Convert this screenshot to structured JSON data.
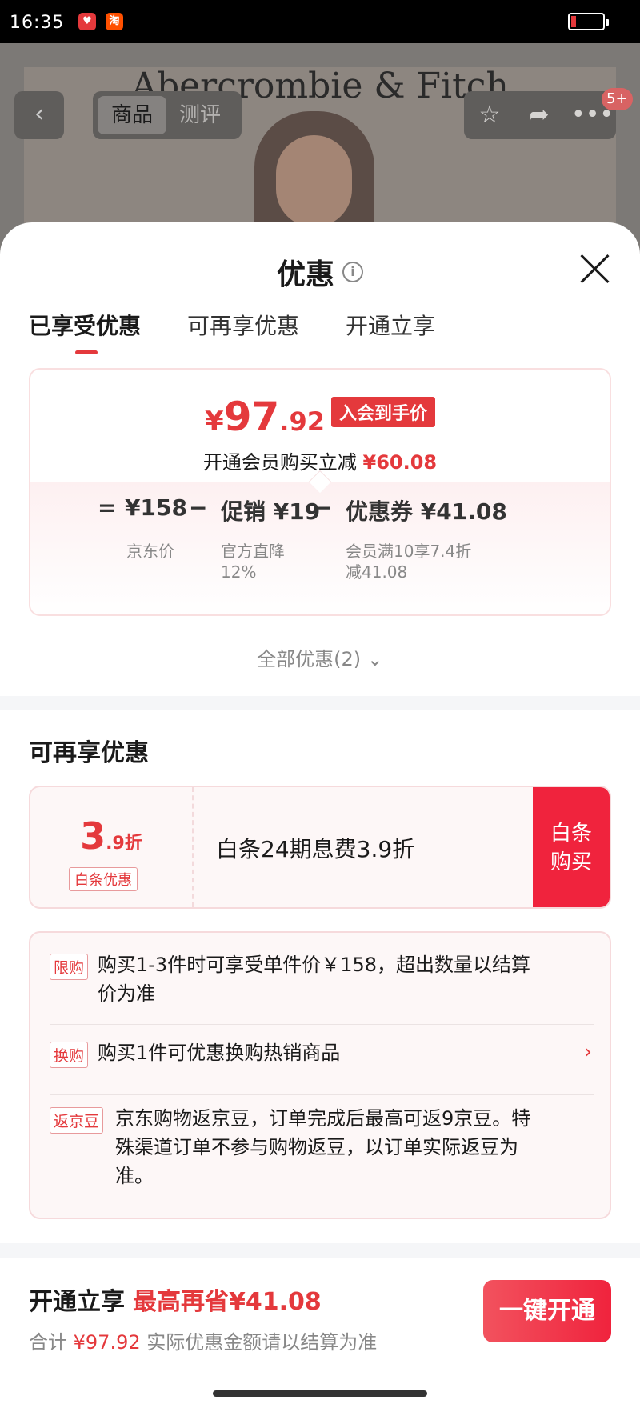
{
  "status_bar": {
    "time": "16:35",
    "app_icons": [
      "jd-app-icon",
      "taobao-app-icon"
    ],
    "taobao_glyph": "淘"
  },
  "background_page": {
    "brand": "Abercrombie & Fitch",
    "tabs": [
      "商品",
      "测评"
    ],
    "badge": "5+"
  },
  "sheet": {
    "title": "优惠",
    "tabs": [
      "已享受优惠",
      "可再享优惠",
      "开通立享"
    ],
    "price": {
      "yen": "¥",
      "int": "97",
      "dec": ".92",
      "tag": "入会到手价",
      "sub_text": "开通会员购买立减",
      "sub_amount": "¥60.08"
    },
    "calc": {
      "eq": "=",
      "minus": "−",
      "jd_price": "¥158",
      "jd_price_label": "京东价",
      "promo": "促销 ¥19",
      "promo_label_1": "官方直降",
      "promo_label_2": "12%",
      "coupon": "优惠券 ¥41.08",
      "coupon_label_1": "会员满10享7.4折",
      "coupon_label_2": "减41.08"
    },
    "all_discounts": "全部优惠(2)",
    "more_section_title": "可再享优惠",
    "baitiao": {
      "rate_big": "3",
      "rate_small": ".9折",
      "badge": "白条优惠",
      "text": "白条24期息费3.9折",
      "button_line1": "白条",
      "button_line2": "购买"
    },
    "rules": [
      {
        "tag": "限购",
        "text_line1": "购买1-3件时可享受单件价￥158，超出数量以结算",
        "text_line2": "价为准"
      },
      {
        "tag": "换购",
        "text_line1": "购买1件可优惠换购热销商品"
      },
      {
        "tag": "返京豆",
        "text_line1": "京东购物返京豆，订单完成后最高可返9京豆。特",
        "text_line2": "殊渠道订单不参与购物返豆，以订单实际返豆为",
        "text_line3": "准。"
      }
    ],
    "footer": {
      "label": "开通立享",
      "save": "最高再省¥41.08",
      "total_label": "合计",
      "total_amount": "¥97.92",
      "note": "实际优惠金额请以结算为准",
      "button": "一键开通"
    }
  },
  "colors": {
    "accent": "#e4393c",
    "button_red": "#f0233d"
  }
}
